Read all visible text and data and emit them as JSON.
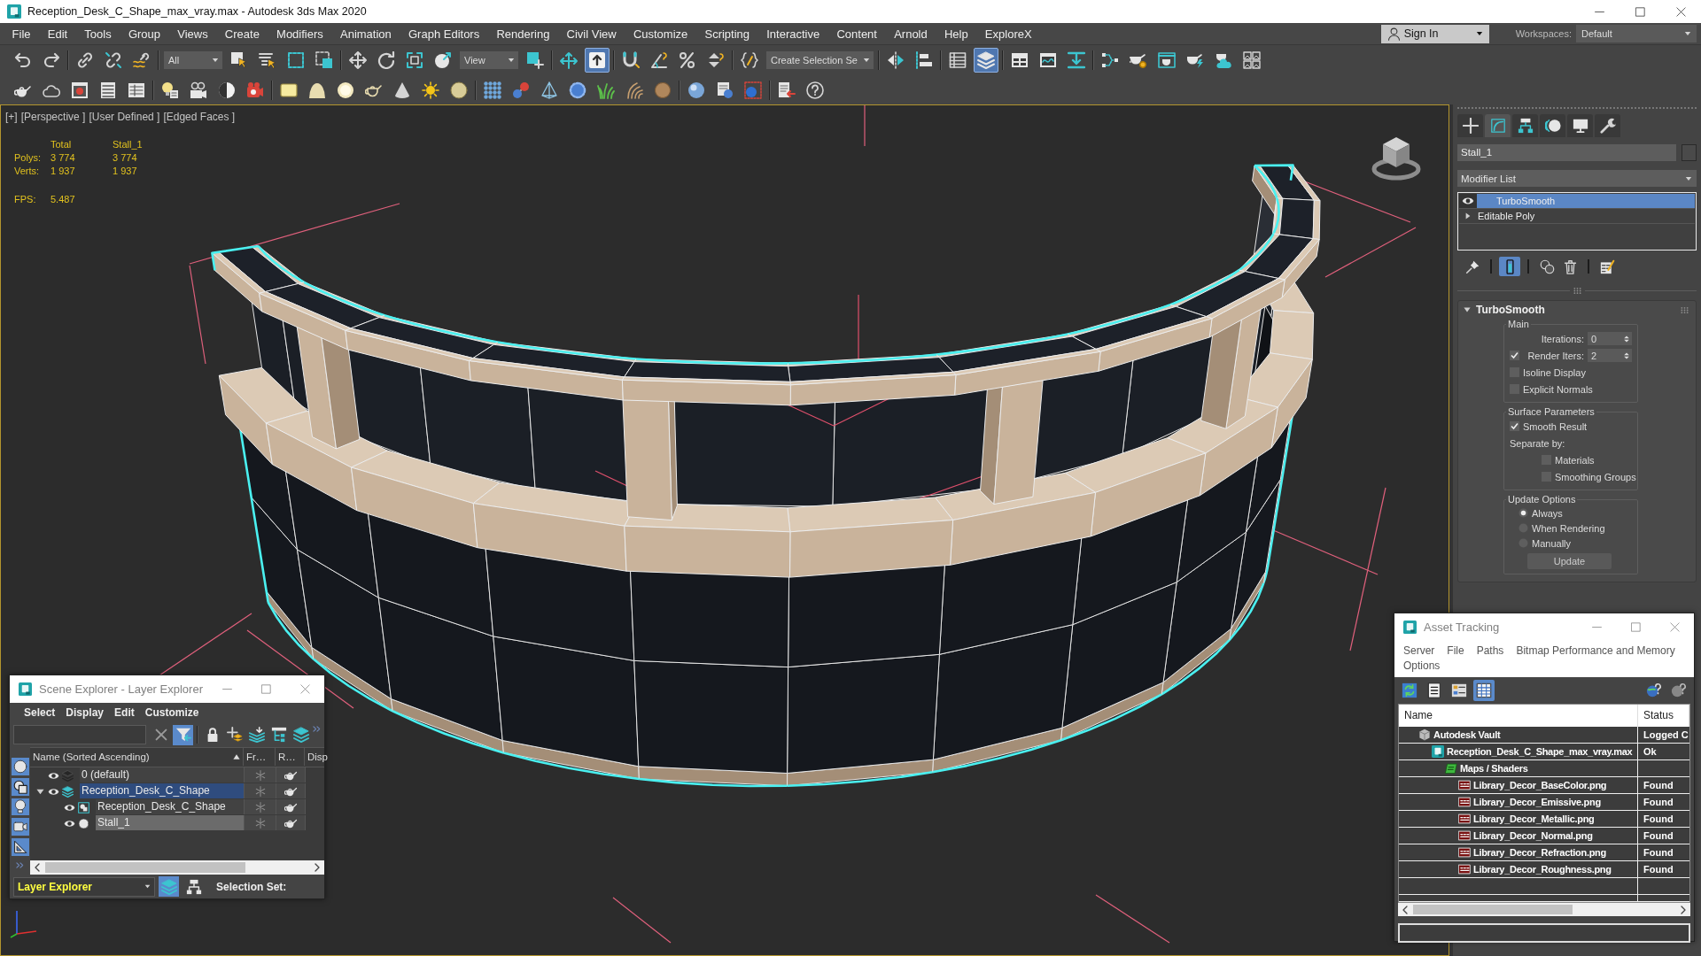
{
  "window": {
    "title": "Reception_Desk_C_Shape_max_vray.max - Autodesk 3ds Max 2020"
  },
  "menu_bar": {
    "items": [
      "File",
      "Edit",
      "Tools",
      "Group",
      "Views",
      "Create",
      "Modifiers",
      "Animation",
      "Graph Editors",
      "Rendering",
      "Civil View",
      "Customize",
      "Scripting",
      "Interactive",
      "Content",
      "Arnold",
      "Help",
      "ExploreX"
    ],
    "account": "Sign In",
    "workspaces_label": "Workspaces:",
    "workspace": "Default"
  },
  "main_toolbar": {
    "groups": [
      [
        {
          "kind": "undo",
          "active": false
        },
        {
          "kind": "redo",
          "active": false
        }
      ],
      [
        {
          "kind": "link",
          "active": false
        },
        {
          "kind": "unlink",
          "active": false
        },
        {
          "kind": "bind",
          "active": false
        }
      ],
      [
        {
          "kind": "dropdown",
          "value": "All"
        },
        {
          "kind": "select",
          "active": false
        },
        {
          "kind": "selectname",
          "active": false
        },
        {
          "kind": "region",
          "active": false
        },
        {
          "kind": "crossing",
          "active": false
        }
      ],
      [
        {
          "kind": "move",
          "active": false
        },
        {
          "kind": "rotate",
          "active": false
        },
        {
          "kind": "scale",
          "active": false
        },
        {
          "kind": "place",
          "active": false
        },
        {
          "kind": "dropdown",
          "value": "View"
        },
        {
          "kind": "pivot",
          "active": false
        }
      ],
      [
        {
          "kind": "manipulate",
          "active": false
        },
        {
          "kind": "override",
          "active": true
        }
      ],
      [
        {
          "kind": "snap",
          "active": false
        },
        {
          "kind": "anglesnap",
          "active": false
        },
        {
          "kind": "percentsnap",
          "active": false
        },
        {
          "kind": "spinnersnap",
          "active": false
        }
      ],
      [
        {
          "kind": "namedsets",
          "active": false
        },
        {
          "kind": "dropdown",
          "value": "Create Selection Se"
        }
      ],
      [
        {
          "kind": "mirror",
          "active": false
        },
        {
          "kind": "align",
          "active": false
        }
      ],
      [
        {
          "kind": "sceneexplorer",
          "active": false
        },
        {
          "kind": "layerexplorer",
          "active": true
        }
      ],
      [
        {
          "kind": "ribbon",
          "active": false
        },
        {
          "kind": "curveeditor",
          "active": false
        },
        {
          "kind": "dopesheet",
          "active": false
        }
      ],
      [
        {
          "kind": "schematic",
          "active": false
        },
        {
          "kind": "materialeditor",
          "active": false
        },
        {
          "kind": "rendersetup",
          "active": false
        },
        {
          "kind": "render",
          "active": false
        },
        {
          "kind": "cloudrender",
          "active": false
        },
        {
          "kind": "viewportgrid",
          "active": false
        }
      ]
    ]
  },
  "secondary_toolbar": {
    "groups": [
      [
        {
          "kind": "teapot",
          "active": false
        },
        {
          "kind": "cloud",
          "active": false
        },
        {
          "kind": "renderwindow",
          "active": false
        },
        {
          "kind": "panellist",
          "active": false
        },
        {
          "kind": "panelgrid",
          "active": false
        }
      ],
      [
        {
          "kind": "lightlister",
          "active": false
        },
        {
          "kind": "camera",
          "active": false
        },
        {
          "kind": "halfmoon",
          "active": false
        },
        {
          "kind": "redcamera",
          "active": false
        }
      ],
      [
        {
          "kind": "plane",
          "active": false
        },
        {
          "kind": "dome",
          "active": false
        },
        {
          "kind": "glowsphere",
          "active": false
        },
        {
          "kind": "teapotoutline",
          "active": false
        },
        {
          "kind": "cone",
          "active": false
        },
        {
          "kind": "sun",
          "active": false
        },
        {
          "kind": "sphere",
          "active": false
        }
      ],
      [
        {
          "kind": "particles",
          "active": false
        },
        {
          "kind": "molecule",
          "active": false
        },
        {
          "kind": "pyramid",
          "active": false
        },
        {
          "kind": "blob",
          "active": false
        },
        {
          "kind": "grass",
          "active": false
        },
        {
          "kind": "hair",
          "active": false
        },
        {
          "kind": "fur",
          "active": false
        }
      ],
      [
        {
          "kind": "bluesphere",
          "active": false
        },
        {
          "kind": "docsphere",
          "active": false
        },
        {
          "kind": "redframe",
          "active": false
        }
      ],
      [
        {
          "kind": "export",
          "active": false
        },
        {
          "kind": "help",
          "active": false
        }
      ]
    ]
  },
  "viewport": {
    "labels": [
      "[+]",
      "[Perspective ]",
      "[User Defined ]",
      "[Edged Faces ]"
    ],
    "stats": {
      "columns": [
        "Total",
        "Stall_1"
      ],
      "rows": [
        {
          "label": "Polys:",
          "values": [
            "3 774",
            "3 774"
          ]
        },
        {
          "label": "Verts:",
          "values": [
            "1 937",
            "1 937"
          ]
        }
      ],
      "fps_label": "FPS:",
      "fps": "5.487"
    }
  },
  "command_panel": {
    "tabs": [
      {
        "kind": "create",
        "selected": false
      },
      {
        "kind": "modify",
        "selected": true
      },
      {
        "kind": "hierarchy",
        "selected": false
      },
      {
        "kind": "motion",
        "selected": false
      },
      {
        "kind": "display",
        "selected": false
      },
      {
        "kind": "utilities",
        "selected": false
      }
    ],
    "object_name": "Stall_1",
    "modifier_list": "Modifier List",
    "stack": [
      {
        "name": "TurboSmooth",
        "kind": "modifier",
        "selected": true,
        "enabled": true
      },
      {
        "name": "Editable Poly",
        "kind": "object",
        "selected": false,
        "expanded": false
      }
    ],
    "stack_tools": [
      [
        {
          "kind": "pin",
          "active": false
        }
      ],
      [
        {
          "kind": "endresult",
          "active": true
        }
      ],
      [
        {
          "kind": "unique",
          "active": false
        },
        {
          "kind": "remove",
          "active": false
        }
      ],
      [
        {
          "kind": "configure",
          "active": false
        }
      ]
    ],
    "rollout": {
      "title": "TurboSmooth",
      "expanded": true,
      "groups": [
        {
          "title": "Main",
          "controls": [
            {
              "kind": "spinner",
              "label": "Iterations:",
              "value": "0"
            },
            {
              "kind": "spinner",
              "label": "Render Iters:",
              "checked": true,
              "value": "2"
            },
            {
              "kind": "checkbox",
              "label": "Isoline Display",
              "checked": false
            },
            {
              "kind": "checkbox",
              "label": "Explicit Normals",
              "checked": false
            }
          ]
        },
        {
          "title": "Surface Parameters",
          "controls": [
            {
              "kind": "checkbox",
              "label": "Smooth Result",
              "checked": true
            },
            {
              "kind": "label",
              "label": "Separate by:",
              "children": [
                {
                  "kind": "checkbox",
                  "label": "Materials",
                  "checked": false
                },
                {
                  "kind": "checkbox",
                  "label": "Smoothing Groups",
                  "checked": false
                }
              ]
            }
          ]
        },
        {
          "title": "Update Options",
          "controls": [
            {
              "kind": "radio",
              "label": "Always",
              "selected": true
            },
            {
              "kind": "radio",
              "label": "When Rendering",
              "selected": false
            },
            {
              "kind": "radio",
              "label": "Manually",
              "selected": false
            },
            {
              "kind": "button",
              "label": "Update"
            }
          ]
        }
      ]
    }
  },
  "scene_explorer": {
    "title": "Scene Explorer - Layer Explorer",
    "menu": [
      "Select",
      "Display",
      "Edit",
      "Customize"
    ],
    "tools": [
      [
        {
          "kind": "clear",
          "active": false
        },
        {
          "kind": "filter",
          "active": true
        }
      ],
      [
        {
          "kind": "lock",
          "active": false
        },
        {
          "kind": "addlayer",
          "active": false
        },
        {
          "kind": "movetolayer",
          "active": false
        },
        {
          "kind": "layertree",
          "active": false
        },
        {
          "kind": "layerstack",
          "active": false
        }
      ]
    ],
    "filters": [
      {
        "kind": "geometry",
        "active": true
      },
      {
        "kind": "shapes",
        "active": true
      },
      {
        "kind": "lights",
        "active": true
      },
      {
        "kind": "cameras",
        "active": true
      },
      {
        "kind": "helpers",
        "active": true
      }
    ],
    "columns": [
      "Name (Sorted Ascending)",
      "Fr…",
      "R…",
      "Disp"
    ],
    "layers": [
      {
        "name": "0 (default)",
        "visible": true,
        "current": false,
        "selected": false
      },
      {
        "name": "Reception_Desk_C_Shape",
        "visible": true,
        "current": true,
        "selected": true,
        "expanded": true,
        "children": [
          {
            "name": "Reception_Desk_C_Shape",
            "kind": "container",
            "visible": true,
            "selected": false
          },
          {
            "name": "Stall_1",
            "kind": "geometry",
            "visible": true,
            "selected": true
          }
        ]
      }
    ],
    "bottom": {
      "mode": "Layer Explorer",
      "tools": [
        {
          "kind": "layerstack",
          "active": true
        },
        {
          "kind": "tree",
          "active": false
        }
      ],
      "selection_label": "Selection Set:"
    }
  },
  "asset_tracking": {
    "title": "Asset Tracking",
    "menu": [
      "Server",
      "File",
      "Paths",
      "Bitmap Performance and Memory",
      "Options"
    ],
    "tools": [
      {
        "kind": "refresh",
        "active": false
      },
      {
        "kind": "list",
        "active": false
      },
      {
        "kind": "thumbnails",
        "active": false
      },
      {
        "kind": "table",
        "active": true
      }
    ],
    "help_tools": [
      {
        "kind": "globehelp",
        "active": false
      },
      {
        "kind": "helpgray",
        "active": false
      }
    ],
    "columns": [
      "Name",
      "Status"
    ],
    "assets": [
      {
        "name": "Autodesk Vault",
        "kind": "vault",
        "status": "Logged C",
        "children": [
          {
            "name": "Reception_Desk_C_Shape_max_vray.max",
            "kind": "scene",
            "status": "Ok",
            "children": [
              {
                "name": "Maps / Shaders",
                "kind": "maps",
                "children": [
                  {
                    "name": "Library_Decor_BaseColor.png",
                    "kind": "image",
                    "status": "Found"
                  },
                  {
                    "name": "Library_Decor_Emissive.png",
                    "kind": "image",
                    "status": "Found"
                  },
                  {
                    "name": "Library_Decor_Metallic.png",
                    "kind": "image",
                    "status": "Found"
                  },
                  {
                    "name": "Library_Decor_Normal.png",
                    "kind": "image",
                    "status": "Found"
                  },
                  {
                    "name": "Library_Decor_Refraction.png",
                    "kind": "image",
                    "status": "Found"
                  },
                  {
                    "name": "Library_Decor_Roughness.png",
                    "kind": "image",
                    "status": "Found"
                  }
                ]
              }
            ]
          }
        ]
      }
    ]
  }
}
